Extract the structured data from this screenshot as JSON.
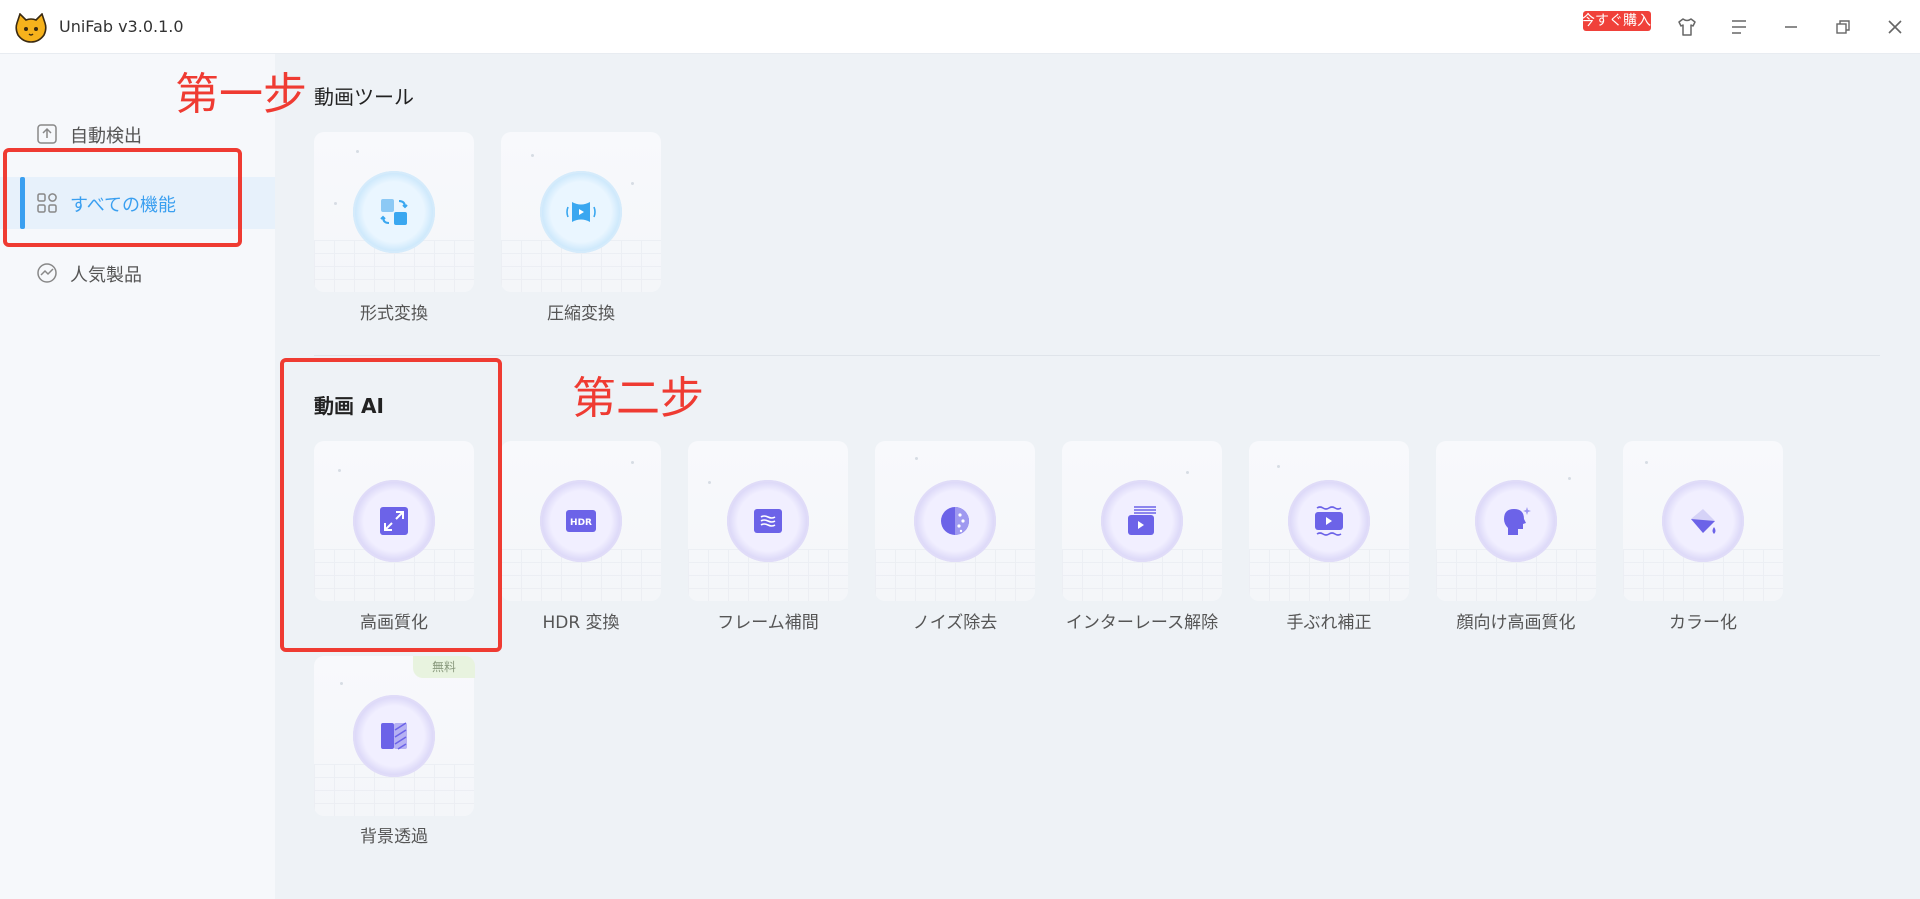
{
  "titlebar": {
    "app_name": "UniFab v3.0.1.0",
    "buy_label": "今すぐ購入",
    "icons": [
      "cat-logo-icon",
      "shirt-icon",
      "menu-icon",
      "minimize-icon",
      "restore-icon",
      "close-icon"
    ]
  },
  "sidebar": {
    "items": [
      {
        "label": "自動検出",
        "icon": "auto-detect-icon"
      },
      {
        "label": "すべての機能",
        "icon": "grid-icon",
        "active": true
      },
      {
        "label": "人気製品",
        "icon": "trend-icon"
      }
    ]
  },
  "sections": {
    "video_tools": {
      "title": "動画ツール",
      "cards": [
        {
          "label": "形式変換",
          "icon": "convert-icon"
        },
        {
          "label": "圧縮変換",
          "icon": "compress-icon"
        }
      ]
    },
    "video_ai": {
      "title": "動画 AI",
      "cards": [
        {
          "label": "高画質化",
          "icon": "upscale-icon"
        },
        {
          "label": "HDR 変換",
          "icon": "hdr-icon"
        },
        {
          "label": "フレーム補間",
          "icon": "frame-interpolation-icon"
        },
        {
          "label": "ノイズ除去",
          "icon": "denoise-icon"
        },
        {
          "label": "インターレース解除",
          "icon": "deinterlace-icon"
        },
        {
          "label": "手ぶれ補正",
          "icon": "stabilize-icon"
        },
        {
          "label": "顔向け高画質化",
          "icon": "face-enhance-icon"
        },
        {
          "label": "カラー化",
          "icon": "colorize-icon"
        },
        {
          "label": "背景透過",
          "icon": "background-remove-icon",
          "badge": "無料"
        }
      ]
    }
  },
  "annotations": {
    "step1": "第一步",
    "step2": "第二步"
  },
  "colors": {
    "accent": "#3a9ff0",
    "annotation": "#ef3b32",
    "ai_icon": "#6c63e8",
    "tool_icon": "#3aa7f0"
  }
}
